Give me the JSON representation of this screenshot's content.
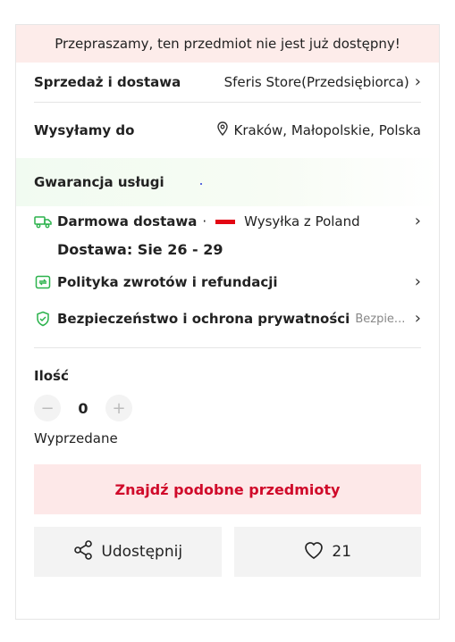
{
  "banner": {
    "text": "Przepraszamy, ten przedmiot nie jest już dostępny!"
  },
  "sales": {
    "label": "Sprzedaż i dostawa",
    "store": "Sferis Store(Przedsiębiorca)"
  },
  "shipping_to": {
    "label": "Wysyłamy do",
    "location": "Kraków, Małopolskie, Polska"
  },
  "guarantee": {
    "title": "Gwarancja usługi",
    "free_shipping": {
      "title": "Darmowa dostawa",
      "separator": " · ",
      "ship_from": "Wysyłka z Poland",
      "delivery": "Dostawa: Sie 26 - 29"
    },
    "returns": {
      "title": "Polityka zwrotów i refundacji"
    },
    "privacy": {
      "title": "Bezpieczeństwo i ochrona prywatności",
      "hint": "Bezpie..."
    }
  },
  "quantity": {
    "label": "Ilość",
    "minus": "−",
    "value": "0",
    "plus": "+",
    "status": "Wyprzedane"
  },
  "buttons": {
    "find_similar": "Znajdź podobne przedmioty",
    "share": "Udostępnij",
    "likes": "21"
  },
  "colors": {
    "accent_red": "#d00a2a",
    "green_icon": "#2bb24c",
    "banner_bg": "#fdecea"
  },
  "icons": [
    "location-pin-icon",
    "truck-icon",
    "return-icon",
    "shield-check-icon",
    "share-icon",
    "heart-icon",
    "chevron-right-icon"
  ]
}
